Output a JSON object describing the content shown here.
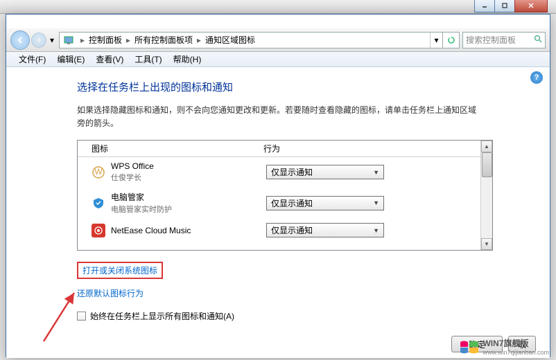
{
  "window": {
    "controls": {
      "min": "minimize",
      "max": "maximize",
      "close": "close"
    }
  },
  "nav": {
    "breadcrumbs": [
      "控制面板",
      "所有控制面板项",
      "通知区域图标"
    ],
    "search_placeholder": "搜索控制面板"
  },
  "menu": {
    "items": [
      "文件(F)",
      "编辑(E)",
      "查看(V)",
      "工具(T)",
      "帮助(H)"
    ]
  },
  "page": {
    "title": "选择在任务栏上出现的图标和通知",
    "desc": "如果选择隐藏图标和通知，则不会向您通知更改和更新。若要随时查看隐藏的图标，请单击任务栏上通知区域旁的箭头。",
    "headers": {
      "icon": "图标",
      "behavior": "行为"
    },
    "rows": [
      {
        "name": "WPS Office",
        "sub": "仕俊学长",
        "iconColor": "#d9a34a",
        "select": "仅显示通知"
      },
      {
        "name": "电脑管家",
        "sub": "电脑管家实时防护",
        "iconColor": "#2f8fd6",
        "select": "仅显示通知"
      },
      {
        "name": "NetEase Cloud Music",
        "sub": "",
        "iconColor": "#d7382e",
        "select": "仅显示通知"
      }
    ],
    "link_system": "打开或关闭系统图标",
    "link_restore": "还原默认图标行为",
    "chk_label": "始终在任务栏上显示所有图标和通知(A)",
    "ok": "确定",
    "cancel": "取"
  },
  "watermark": "WIN7旗舰版",
  "watermark_url": "www.win7qijianban.com"
}
